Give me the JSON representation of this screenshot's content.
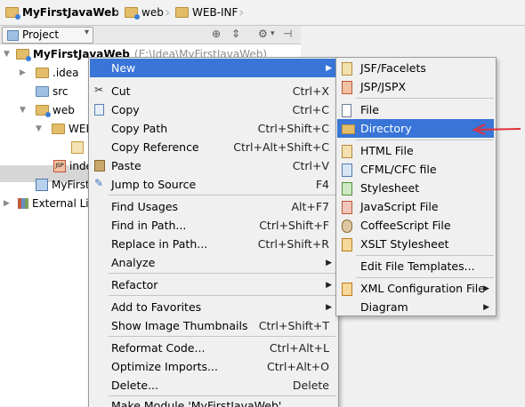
{
  "breadcrumb": {
    "project": "MyFirstJavaWeb",
    "web": "web",
    "webinf": "WEB-INF"
  },
  "project_panel": {
    "view_label": "Project"
  },
  "tree": {
    "root_name": "MyFirstJavaWeb",
    "root_path": "(E:\\Idea\\MyFirstJavaWeb)",
    "idea": ".idea",
    "src": "src",
    "web": "web",
    "webinf": "WEB",
    "index": "inde",
    "iml": "MyFirst",
    "external": "External Lil"
  },
  "context_menu": {
    "new": "New",
    "cut": "Cut",
    "cut_sc": "Ctrl+X",
    "copy": "Copy",
    "copy_sc": "Ctrl+C",
    "copy_path": "Copy Path",
    "copy_path_sc": "Ctrl+Shift+C",
    "copy_ref": "Copy Reference",
    "copy_ref_sc": "Ctrl+Alt+Shift+C",
    "paste": "Paste",
    "paste_sc": "Ctrl+V",
    "jump": "Jump to Source",
    "jump_sc": "F4",
    "find_usages": "Find Usages",
    "find_usages_sc": "Alt+F7",
    "find_path": "Find in Path...",
    "find_path_sc": "Ctrl+Shift+F",
    "replace_path": "Replace in Path...",
    "replace_path_sc": "Ctrl+Shift+R",
    "analyze": "Analyze",
    "refactor": "Refactor",
    "favorites": "Add to Favorites",
    "thumbnails": "Show Image Thumbnails",
    "thumbnails_sc": "Ctrl+Shift+T",
    "reformat": "Reformat Code...",
    "reformat_sc": "Ctrl+Alt+L",
    "optimize": "Optimize Imports...",
    "optimize_sc": "Ctrl+Alt+O",
    "delete": "Delete...",
    "delete_sc": "Delete",
    "make_module": "Make Module 'MyFirstJavaWeb'"
  },
  "new_submenu": {
    "jsf": "JSF/Facelets",
    "jspx": "JSP/JSPX",
    "file": "File",
    "directory": "Directory",
    "html": "HTML File",
    "cfml": "CFML/CFC file",
    "stylesheet": "Stylesheet",
    "javascript": "JavaScript File",
    "coffeescript": "CoffeeScript File",
    "xslt": "XSLT Stylesheet",
    "edit_templates": "Edit File Templates...",
    "xml_config": "XML Configuration File",
    "diagram": "Diagram"
  },
  "colors": {
    "highlight": "#3875d7",
    "annotation_arrow": "#e0303a"
  }
}
